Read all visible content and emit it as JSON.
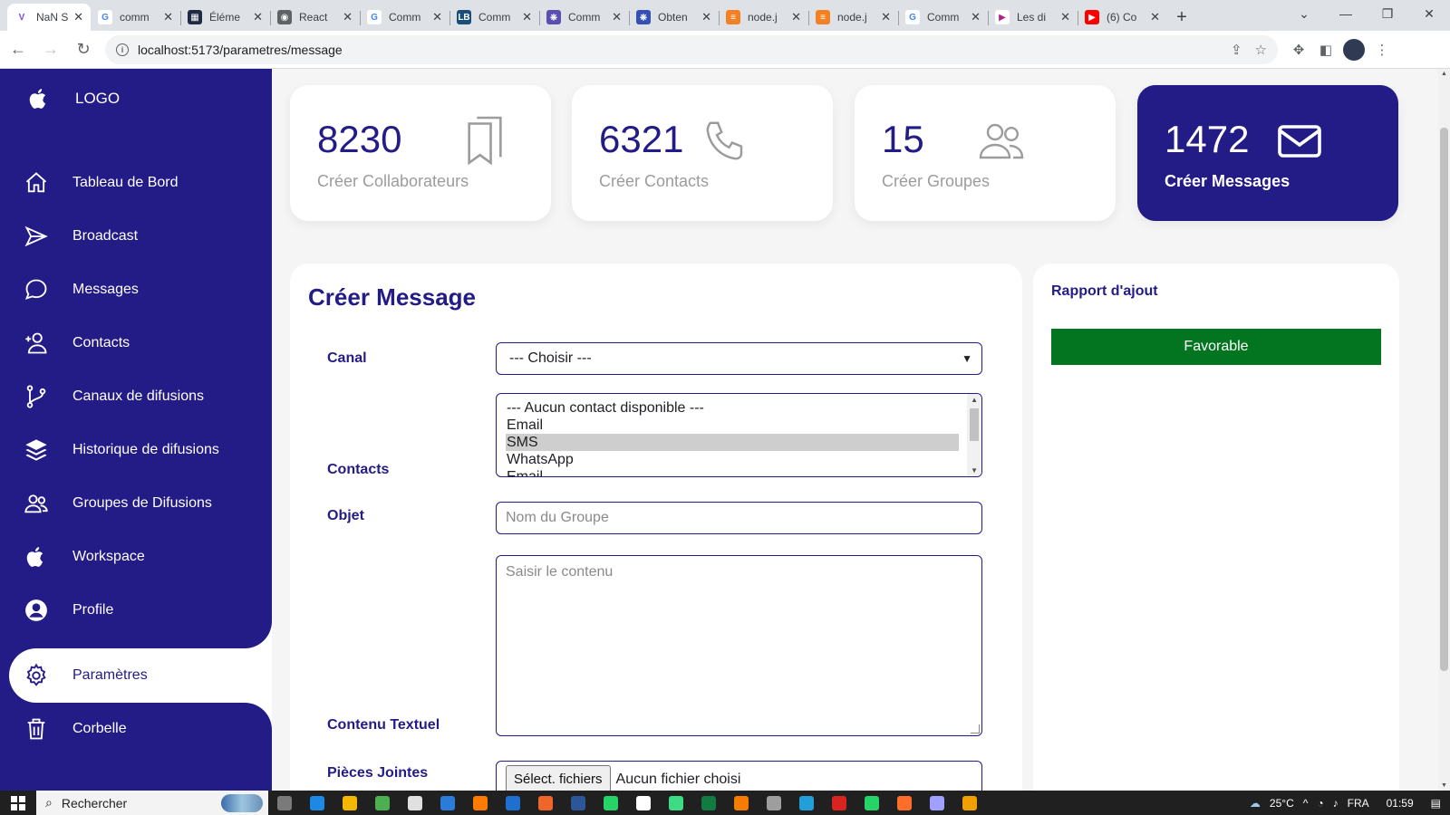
{
  "browser": {
    "tabs": [
      {
        "title": "NaN S",
        "color": "#ffffff",
        "glyph": "V",
        "glyph_color": "#7b4ce0",
        "active": true
      },
      {
        "title": "comm",
        "color": "#ffffff",
        "glyph": "G",
        "glyph_color": "#4285f4"
      },
      {
        "title": "Éléme",
        "color": "#1f2a44",
        "glyph": "▦",
        "glyph_color": "#ffffff"
      },
      {
        "title": "React",
        "color": "#5f6368",
        "glyph": "◉",
        "glyph_color": "#ffffff"
      },
      {
        "title": "Comm",
        "color": "#ffffff",
        "glyph": "G",
        "glyph_color": "#4285f4"
      },
      {
        "title": "Comm",
        "color": "#1b4d7a",
        "glyph": "LB",
        "glyph_color": "#ffffff"
      },
      {
        "title": "Comm",
        "color": "#5a4fb0",
        "glyph": "⎈",
        "glyph_color": "#ffffff"
      },
      {
        "title": "Obten",
        "color": "#3450b4",
        "glyph": "⎈",
        "glyph_color": "#ffffff"
      },
      {
        "title": "node.j",
        "color": "#f48024",
        "glyph": "≡",
        "glyph_color": "#ffffff"
      },
      {
        "title": "node.j",
        "color": "#f48024",
        "glyph": "≡",
        "glyph_color": "#ffffff"
      },
      {
        "title": "Comm",
        "color": "#ffffff",
        "glyph": "G",
        "glyph_color": "#4285f4"
      },
      {
        "title": "Les di",
        "color": "#ffffff",
        "glyph": "▶",
        "glyph_color": "#b0208f"
      },
      {
        "title": "(6) Co",
        "color": "#ff0000",
        "glyph": "▶",
        "glyph_color": "#ffffff"
      }
    ],
    "url": "localhost:5173/parametres/message"
  },
  "sidebar": {
    "logo_label": "LOGO",
    "items": [
      {
        "label": "Tableau de Bord",
        "icon": "home-icon"
      },
      {
        "label": "Broadcast",
        "icon": "send-icon"
      },
      {
        "label": "Messages",
        "icon": "chat-icon"
      },
      {
        "label": "Contacts",
        "icon": "user-add-icon"
      },
      {
        "label": "Canaux de difusions",
        "icon": "branch-icon"
      },
      {
        "label": "Historique de difusions",
        "icon": "layers-icon"
      },
      {
        "label": "Groupes de Difusions",
        "icon": "users-icon"
      },
      {
        "label": "Workspace",
        "icon": "apple-icon"
      },
      {
        "label": "Profile",
        "icon": "profile-icon"
      },
      {
        "label": "Paramètres",
        "icon": "gear-icon",
        "active": true
      },
      {
        "label": "Corbelle",
        "icon": "trash-icon"
      }
    ]
  },
  "cards": [
    {
      "value": "8230",
      "label": "Créer Collaborateurs",
      "icon": "bookmarks-icon"
    },
    {
      "value": "6321",
      "label": "Créer Contacts",
      "icon": "phone-icon"
    },
    {
      "value": "15",
      "label": "Créer Groupes",
      "icon": "people-icon"
    },
    {
      "value": "1472",
      "label": "Créer Messages",
      "icon": "mail-icon",
      "highlight": true
    }
  ],
  "form": {
    "title": "Créer Message",
    "canal_label": "Canal",
    "canal_value": "--- Choisir ---",
    "contacts_label": "Contacts",
    "contacts_options": [
      "--- Aucun contact disponible ---",
      "Email",
      "SMS",
      "WhatsApp",
      "Email"
    ],
    "contacts_selected": "SMS",
    "objet_label": "Objet",
    "objet_placeholder": "Nom du Groupe",
    "contenu_label": "Contenu Textuel",
    "contenu_placeholder": "Saisir le contenu",
    "pieces_label": "Pièces Jointes",
    "file_button": "Sélect. fichiers",
    "file_text": "Aucun fichier choisi"
  },
  "rapport": {
    "title": "Rapport d'ajout",
    "status": "Favorable",
    "status_color": "#037520"
  },
  "colors": {
    "primary": "#231b86",
    "muted": "#9c9c9c"
  },
  "taskbar": {
    "search_placeholder": "Rechercher",
    "weather": "25°C",
    "language": "FRA",
    "time": "01:59"
  }
}
